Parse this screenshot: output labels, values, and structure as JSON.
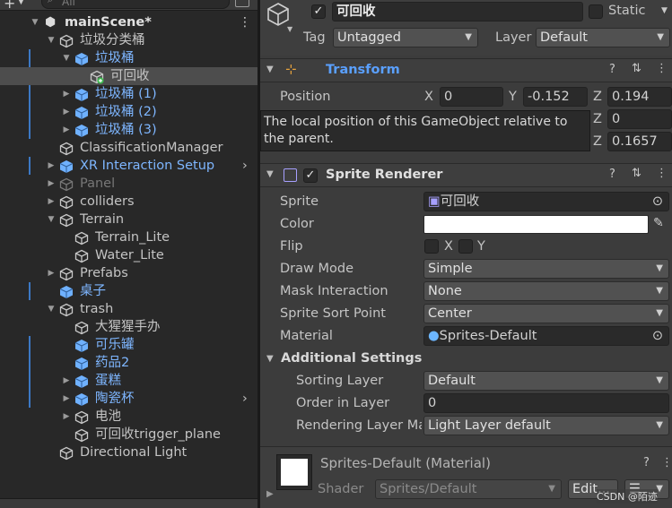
{
  "hierarchy": {
    "search_placeholder": "All",
    "scene_name": "mainScene*",
    "items": [
      {
        "label": "垃圾分类桶",
        "depth": 1,
        "arrow": "▼",
        "icon": "gameobject",
        "color": "normal",
        "marked": false,
        "selected": false,
        "chevron": false
      },
      {
        "label": "垃圾桶",
        "depth": 2,
        "arrow": "▼",
        "icon": "prefab",
        "color": "blue",
        "marked": true,
        "selected": false,
        "chevron": false
      },
      {
        "label": "可回收",
        "depth": 3,
        "arrow": "",
        "icon": "gameobject-add",
        "color": "normal",
        "marked": false,
        "selected": true,
        "chevron": false
      },
      {
        "label": "垃圾桶 (1)",
        "depth": 2,
        "arrow": "▶",
        "icon": "prefab",
        "color": "blue",
        "marked": true,
        "selected": false,
        "chevron": false
      },
      {
        "label": "垃圾桶 (2)",
        "depth": 2,
        "arrow": "▶",
        "icon": "prefab",
        "color": "blue",
        "marked": true,
        "selected": false,
        "chevron": false
      },
      {
        "label": "垃圾桶 (3)",
        "depth": 2,
        "arrow": "▶",
        "icon": "prefab",
        "color": "blue",
        "marked": true,
        "selected": false,
        "chevron": false
      },
      {
        "label": "ClassificationManager",
        "depth": 1,
        "arrow": "",
        "icon": "gameobject",
        "color": "normal",
        "marked": false,
        "selected": false,
        "chevron": false
      },
      {
        "label": "XR Interaction Setup",
        "depth": 1,
        "arrow": "▶",
        "icon": "prefab",
        "color": "blue",
        "marked": true,
        "selected": false,
        "chevron": true
      },
      {
        "label": "Panel",
        "depth": 1,
        "arrow": "▶",
        "icon": "gameobject",
        "color": "grey",
        "marked": false,
        "selected": false,
        "chevron": false
      },
      {
        "label": "colliders",
        "depth": 1,
        "arrow": "▶",
        "icon": "gameobject",
        "color": "normal",
        "marked": false,
        "selected": false,
        "chevron": false
      },
      {
        "label": "Terrain",
        "depth": 1,
        "arrow": "▼",
        "icon": "gameobject",
        "color": "normal",
        "marked": false,
        "selected": false,
        "chevron": false
      },
      {
        "label": "Terrain_Lite",
        "depth": 2,
        "arrow": "",
        "icon": "gameobject",
        "color": "normal",
        "marked": false,
        "selected": false,
        "chevron": false
      },
      {
        "label": "Water_Lite",
        "depth": 2,
        "arrow": "",
        "icon": "gameobject",
        "color": "normal",
        "marked": false,
        "selected": false,
        "chevron": false
      },
      {
        "label": "Prefabs",
        "depth": 1,
        "arrow": "▶",
        "icon": "gameobject",
        "color": "normal",
        "marked": false,
        "selected": false,
        "chevron": false
      },
      {
        "label": "桌子",
        "depth": 1,
        "arrow": "",
        "icon": "prefab",
        "color": "blue",
        "marked": true,
        "selected": false,
        "chevron": false
      },
      {
        "label": "trash",
        "depth": 1,
        "arrow": "▼",
        "icon": "gameobject",
        "color": "normal",
        "marked": false,
        "selected": false,
        "chevron": false
      },
      {
        "label": "大猩猩手办",
        "depth": 2,
        "arrow": "",
        "icon": "gameobject",
        "color": "normal",
        "marked": false,
        "selected": false,
        "chevron": false
      },
      {
        "label": "可乐罐",
        "depth": 2,
        "arrow": "",
        "icon": "prefab",
        "color": "blue",
        "marked": true,
        "selected": false,
        "chevron": false
      },
      {
        "label": "药品2",
        "depth": 2,
        "arrow": "",
        "icon": "prefab",
        "color": "blue",
        "marked": true,
        "selected": false,
        "chevron": false
      },
      {
        "label": "蛋糕",
        "depth": 2,
        "arrow": "▶",
        "icon": "prefab",
        "color": "blue",
        "marked": true,
        "selected": false,
        "chevron": false
      },
      {
        "label": "陶瓷杯",
        "depth": 2,
        "arrow": "▶",
        "icon": "prefab",
        "color": "blue",
        "marked": true,
        "selected": false,
        "chevron": true
      },
      {
        "label": "电池",
        "depth": 2,
        "arrow": "▶",
        "icon": "gameobject",
        "color": "normal",
        "marked": false,
        "selected": false,
        "chevron": false
      },
      {
        "label": "可回收trigger_plane",
        "depth": 2,
        "arrow": "",
        "icon": "gameobject",
        "color": "normal",
        "marked": false,
        "selected": false,
        "chevron": false
      },
      {
        "label": "Directional Light",
        "depth": 1,
        "arrow": "",
        "icon": "gameobject",
        "color": "normal",
        "marked": false,
        "selected": false,
        "chevron": false
      }
    ]
  },
  "inspector": {
    "object_name": "可回收",
    "active_checked": true,
    "static_label": "Static",
    "tag_label": "Tag",
    "tag_value": "Untagged",
    "layer_label": "Layer",
    "layer_value": "Default",
    "transform": {
      "title": "Transform",
      "position_label": "Position",
      "x_label": "X",
      "y_label": "Y",
      "z_label": "Z",
      "pos_x": "0",
      "pos_y": "-0.152",
      "pos_z": "0.194",
      "rot_z": "0",
      "scale_z": "0.1657",
      "tooltip": "The local position of this GameObject relative to the parent."
    },
    "sprite_renderer": {
      "title": "Sprite Renderer",
      "enabled": true,
      "sprite_label": "Sprite",
      "sprite_value": "可回收",
      "color_label": "Color",
      "color_value": "#ffffff",
      "flip_label": "Flip",
      "flip_x": "X",
      "flip_y": "Y",
      "draw_mode_label": "Draw Mode",
      "draw_mode_value": "Simple",
      "mask_label": "Mask Interaction",
      "mask_value": "None",
      "sort_point_label": "Sprite Sort Point",
      "sort_point_value": "Center",
      "material_label": "Material",
      "material_value": "Sprites-Default",
      "additional_label": "Additional Settings",
      "sorting_layer_label": "Sorting Layer",
      "sorting_layer_value": "Default",
      "order_label": "Order in Layer",
      "order_value": "0",
      "rendering_layer_label": "Rendering Layer Ma",
      "rendering_layer_value": "Light Layer default"
    },
    "material": {
      "name": "Sprites-Default (Material)",
      "shader_label": "Shader",
      "shader_value": "Sprites/Default",
      "edit_label": "Edit...",
      "menu_label": "☰"
    },
    "watermark": "CSDN @陌迹"
  }
}
